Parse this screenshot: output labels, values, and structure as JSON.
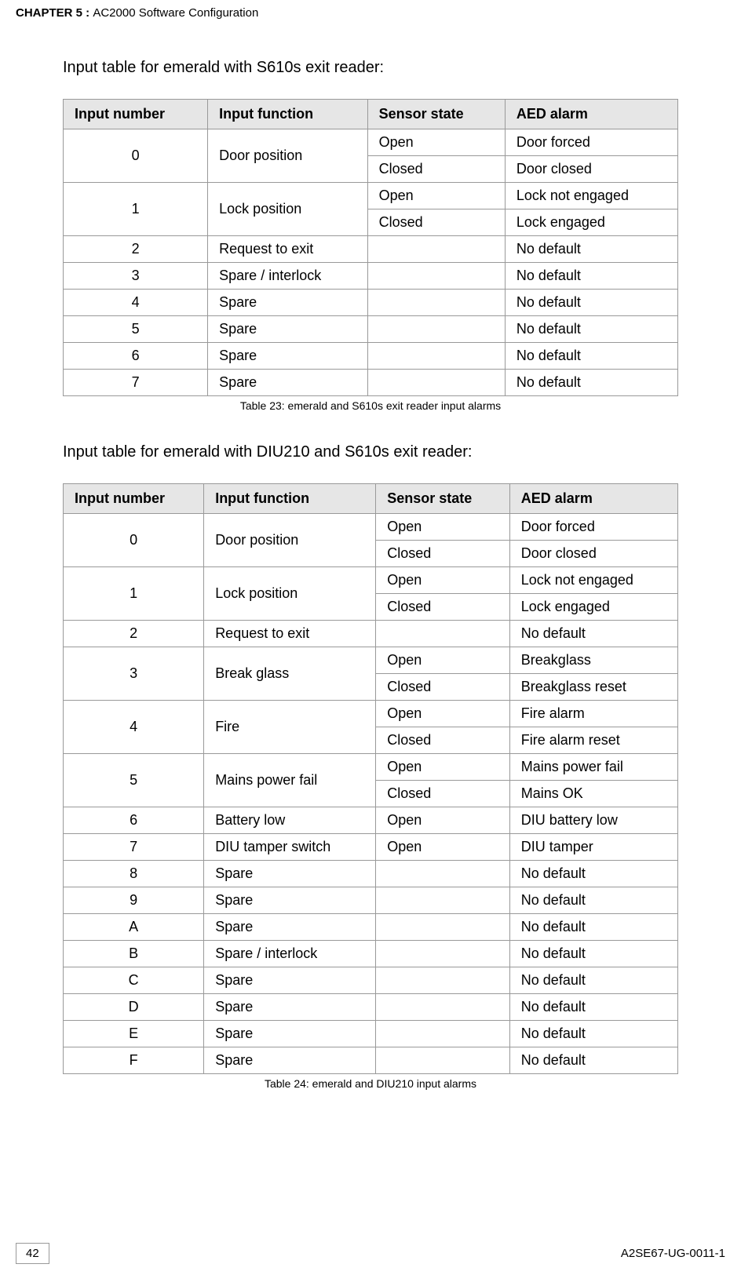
{
  "header": {
    "chapter": "CHAPTER 5 : ",
    "title": "AC2000 Software Configuration"
  },
  "section1": {
    "title": "Input table for emerald with S610s exit reader:",
    "caption": "Table 23: emerald and S610s exit reader input alarms",
    "headers": [
      "Input number",
      "Input function",
      "Sensor state",
      "AED alarm"
    ]
  },
  "section2": {
    "title": "Input table for emerald with DIU210 and S610s exit reader:",
    "caption": "Table 24: emerald and DIU210 input alarms",
    "headers": [
      "Input number",
      "Input function",
      "Sensor state",
      "AED alarm"
    ]
  },
  "chart_data": [
    {
      "type": "table",
      "title": "emerald and S610s exit reader input alarms",
      "columns": [
        "Input number",
        "Input function",
        "Sensor state",
        "AED alarm"
      ],
      "rows": [
        {
          "input_number": "0",
          "input_function": "Door position",
          "sensor_state": "Open",
          "aed_alarm": "Door forced"
        },
        {
          "input_number": "0",
          "input_function": "Door position",
          "sensor_state": "Closed",
          "aed_alarm": "Door closed"
        },
        {
          "input_number": "1",
          "input_function": "Lock position",
          "sensor_state": "Open",
          "aed_alarm": "Lock not engaged"
        },
        {
          "input_number": "1",
          "input_function": "Lock position",
          "sensor_state": "Closed",
          "aed_alarm": "Lock engaged"
        },
        {
          "input_number": "2",
          "input_function": "Request to exit",
          "sensor_state": "",
          "aed_alarm": "No default"
        },
        {
          "input_number": "3",
          "input_function": "Spare / interlock",
          "sensor_state": "",
          "aed_alarm": "No default"
        },
        {
          "input_number": "4",
          "input_function": "Spare",
          "sensor_state": "",
          "aed_alarm": "No default"
        },
        {
          "input_number": "5",
          "input_function": "Spare",
          "sensor_state": "",
          "aed_alarm": "No default"
        },
        {
          "input_number": "6",
          "input_function": "Spare",
          "sensor_state": "",
          "aed_alarm": "No default"
        },
        {
          "input_number": "7",
          "input_function": "Spare",
          "sensor_state": "",
          "aed_alarm": "No default"
        }
      ]
    },
    {
      "type": "table",
      "title": "emerald and DIU210 input alarms",
      "columns": [
        "Input number",
        "Input function",
        "Sensor state",
        "AED alarm"
      ],
      "rows": [
        {
          "input_number": "0",
          "input_function": "Door position",
          "sensor_state": "Open",
          "aed_alarm": "Door forced"
        },
        {
          "input_number": "0",
          "input_function": "Door position",
          "sensor_state": "Closed",
          "aed_alarm": "Door closed"
        },
        {
          "input_number": "1",
          "input_function": "Lock position",
          "sensor_state": "Open",
          "aed_alarm": "Lock not engaged"
        },
        {
          "input_number": "1",
          "input_function": "Lock position",
          "sensor_state": "Closed",
          "aed_alarm": "Lock engaged"
        },
        {
          "input_number": "2",
          "input_function": "Request to exit",
          "sensor_state": "",
          "aed_alarm": "No default"
        },
        {
          "input_number": "3",
          "input_function": "Break glass",
          "sensor_state": "Open",
          "aed_alarm": "Breakglass"
        },
        {
          "input_number": "3",
          "input_function": "Break glass",
          "sensor_state": "Closed",
          "aed_alarm": "Breakglass reset"
        },
        {
          "input_number": "4",
          "input_function": "Fire",
          "sensor_state": "Open",
          "aed_alarm": "Fire alarm"
        },
        {
          "input_number": "4",
          "input_function": "Fire",
          "sensor_state": "Closed",
          "aed_alarm": "Fire alarm reset"
        },
        {
          "input_number": "5",
          "input_function": "Mains power fail",
          "sensor_state": "Open",
          "aed_alarm": "Mains power fail"
        },
        {
          "input_number": "5",
          "input_function": "Mains power fail",
          "sensor_state": "Closed",
          "aed_alarm": "Mains OK"
        },
        {
          "input_number": "6",
          "input_function": "Battery low",
          "sensor_state": "Open",
          "aed_alarm": "DIU battery low"
        },
        {
          "input_number": "7",
          "input_function": "DIU tamper switch",
          "sensor_state": "Open",
          "aed_alarm": "DIU tamper"
        },
        {
          "input_number": "8",
          "input_function": "Spare",
          "sensor_state": "",
          "aed_alarm": "No default"
        },
        {
          "input_number": "9",
          "input_function": "Spare",
          "sensor_state": "",
          "aed_alarm": "No default"
        },
        {
          "input_number": "A",
          "input_function": "Spare",
          "sensor_state": "",
          "aed_alarm": "No default"
        },
        {
          "input_number": "B",
          "input_function": "Spare / interlock",
          "sensor_state": "",
          "aed_alarm": "No default"
        },
        {
          "input_number": "C",
          "input_function": "Spare",
          "sensor_state": "",
          "aed_alarm": "No default"
        },
        {
          "input_number": "D",
          "input_function": "Spare",
          "sensor_state": "",
          "aed_alarm": "No default"
        },
        {
          "input_number": "E",
          "input_function": "Spare",
          "sensor_state": "",
          "aed_alarm": "No default"
        },
        {
          "input_number": "F",
          "input_function": "Spare",
          "sensor_state": "",
          "aed_alarm": "No default"
        }
      ]
    }
  ],
  "footer": {
    "page": "42",
    "doc_id": "A2SE67-UG-0011-1"
  }
}
